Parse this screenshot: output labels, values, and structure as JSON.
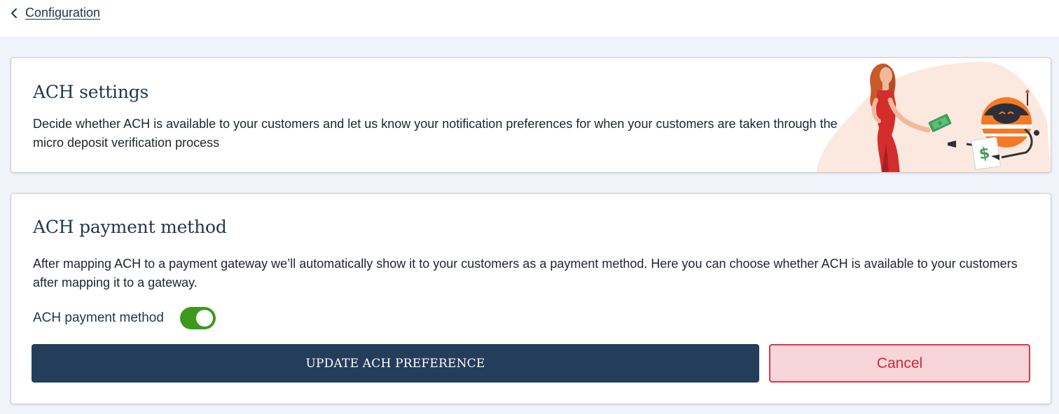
{
  "nav": {
    "back_label": "Configuration"
  },
  "settings_card": {
    "title": "ACH settings",
    "description": "Decide whether ACH is available to your customers and let us know your notification preferences for when your customers are taken through the micro deposit verification process"
  },
  "method_card": {
    "title": "ACH payment method",
    "description": "After mapping ACH to a payment gateway we’ll automatically show it to your customers as a payment method. Here you can choose whether ACH is available to your customers after mapping it to a gateway.",
    "toggle_label": "ACH payment method",
    "toggle_on": true,
    "update_button": "UPDATE ACH PREFERENCE",
    "cancel_button": "Cancel"
  },
  "icons": [
    "chevron-left-icon",
    "woman-robot-money-illustration"
  ],
  "colors": {
    "primary": "#243d5a",
    "toggle_on": "#3b9a1c",
    "cancel_bg": "#f7d5d8",
    "cancel_border": "#d73a4a",
    "background": "#f0f4fa"
  }
}
